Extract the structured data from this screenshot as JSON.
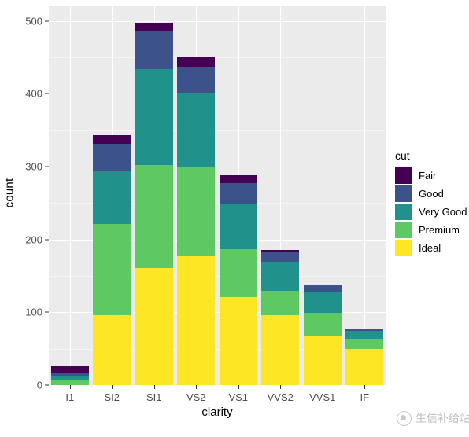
{
  "chart_data": {
    "type": "bar",
    "stacked": true,
    "title": "",
    "xlabel": "clarity",
    "ylabel": "count",
    "categories": [
      "I1",
      "SI2",
      "SI1",
      "VS2",
      "VS1",
      "VVS2",
      "VVS1",
      "IF"
    ],
    "ylim": [
      0,
      520
    ],
    "yticks": [
      0,
      100,
      200,
      300,
      400,
      500
    ],
    "ytick_labels": [
      "0",
      "100",
      "200",
      "300",
      "400",
      "500"
    ],
    "grid": true,
    "legend_title": "cut",
    "legend_position": "right",
    "series": [
      {
        "name": "Ideal",
        "color": "#fde725",
        "values": [
          0,
          96,
          161,
          177,
          121,
          96,
          67,
          50
        ]
      },
      {
        "name": "Premium",
        "color": "#5ec962",
        "values": [
          8,
          125,
          141,
          122,
          66,
          33,
          32,
          14
        ]
      },
      {
        "name": "Very Good",
        "color": "#21918c",
        "values": [
          4,
          73,
          132,
          102,
          61,
          40,
          29,
          10
        ]
      },
      {
        "name": "Good",
        "color": "#3b528b",
        "values": [
          4,
          37,
          52,
          36,
          29,
          14,
          9,
          4
        ]
      },
      {
        "name": "Fair",
        "color": "#440154",
        "values": [
          10,
          12,
          11,
          14,
          11,
          3,
          0,
          0
        ]
      }
    ],
    "totals": [
      26,
      343,
      497,
      451,
      288,
      186,
      137,
      78
    ],
    "stack_order_bottom_to_top": [
      "Ideal",
      "Premium",
      "Very Good",
      "Good",
      "Fair"
    ]
  },
  "legend": {
    "title": "cut",
    "items": [
      {
        "label": "Fair",
        "color": "#440154"
      },
      {
        "label": "Good",
        "color": "#3b528b"
      },
      {
        "label": "Very Good",
        "color": "#21918c"
      },
      {
        "label": "Premium",
        "color": "#5ec962"
      },
      {
        "label": "Ideal",
        "color": "#fde725"
      }
    ]
  },
  "watermark": {
    "text": "生信补给站"
  },
  "theme": {
    "panel_background": "#ebebeb",
    "grid_major_color": "#ffffff",
    "grid_minor_color": "#f5f5f5",
    "text_color": "#4d4d4d",
    "title_color": "#000000"
  }
}
